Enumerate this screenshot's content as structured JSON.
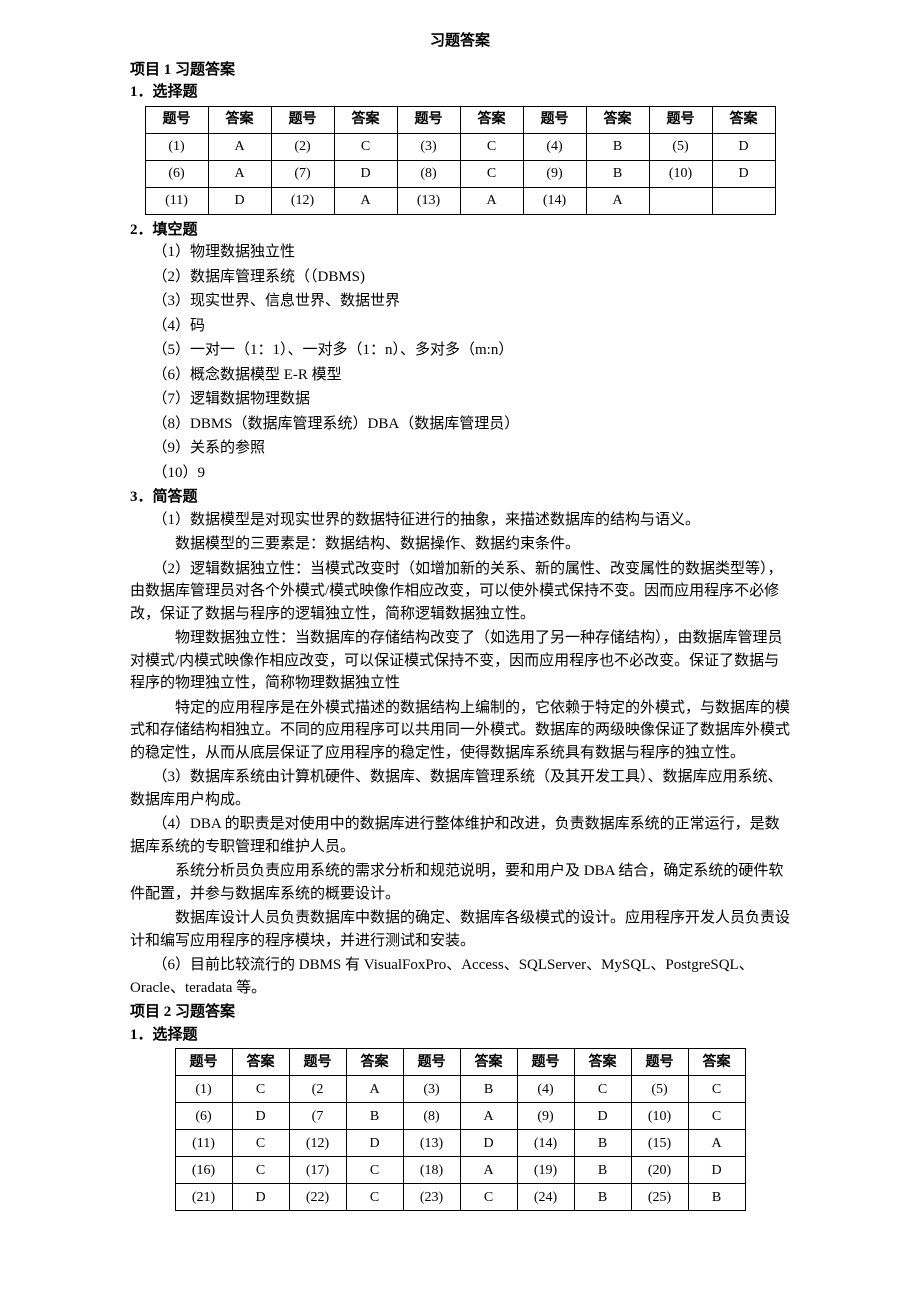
{
  "page_title": "习题答案",
  "project1": {
    "heading": "项目 1 习题答案",
    "section1": {
      "heading": "1．选择题",
      "headers": [
        "题号",
        "答案",
        "题号",
        "答案",
        "题号",
        "答案",
        "题号",
        "答案",
        "题号",
        "答案"
      ],
      "rows": [
        [
          "(1)",
          "A",
          "(2)",
          "C",
          "(3)",
          "C",
          "(4)",
          "B",
          "(5)",
          "D"
        ],
        [
          "(6)",
          "A",
          "(7)",
          "D",
          "(8)",
          "C",
          "(9)",
          "B",
          "(10)",
          "D"
        ],
        [
          "(11)",
          "D",
          "(12)",
          "A",
          "(13)",
          "A",
          "(14)",
          "A",
          "",
          ""
        ]
      ]
    },
    "section2": {
      "heading": "2．填空题",
      "items": [
        "（1）物理数据独立性",
        "（2）数据库管理系统（（DBMS)",
        "（3）现实世界、信息世界、数据世界",
        "（4）码",
        "（5）一对一（1：1）、一对多（1：n）、多对多（m:n）",
        "（6）概念数据模型 E-R 模型",
        "（7）逻辑数据物理数据",
        "（8）DBMS（数据库管理系统）DBA（数据库管理员）",
        "（9）关系的参照",
        "（10）9"
      ]
    },
    "section3": {
      "heading": "3．简答题",
      "paras": [
        {
          "cls": "indent",
          "text": "（1）数据模型是对现实世界的数据特征进行的抽象，来描述数据库的结构与语义。"
        },
        {
          "cls": "indent2",
          "text": "数据模型的三要素是：数据结构、数据操作、数据约束条件。"
        },
        {
          "cls": "indent",
          "text": "（2）逻辑数据独立性：当模式改变时（如增加新的关系、新的属性、改变属性的数据类型等），由数据库管理员对各个外模式/模式映像作相应改变，可以使外模式保持不变。因而应用程序不必修改，保证了数据与程序的逻辑独立性，简称逻辑数据独立性。"
        },
        {
          "cls": "indent2",
          "text": "物理数据独立性：当数据库的存储结构改变了（如选用了另一种存储结构），由数据库管理员对模式/内模式映像作相应改变，可以保证模式保持不变，因而应用程序也不必改变。保证了数据与程序的物理独立性，简称物理数据独立性"
        },
        {
          "cls": "indent2",
          "text": "特定的应用程序是在外模式描述的数据结构上编制的，它依赖于特定的外模式，与数据库的模式和存储结构相独立。不同的应用程序可以共用同一外模式。数据库的两级映像保证了数据库外模式的稳定性，从而从底层保证了应用程序的稳定性，使得数据库系统具有数据与程序的独立性。"
        },
        {
          "cls": "indent",
          "text": "（3）数据库系统由计算机硬件、数据库、数据库管理系统（及其开发工具）、数据库应用系统、数据库用户构成。"
        },
        {
          "cls": "indent",
          "text": "（4）DBA 的职责是对使用中的数据库进行整体维护和改进，负责数据库系统的正常运行，是数据库系统的专职管理和维护人员。"
        },
        {
          "cls": "indent2",
          "text": "系统分析员负责应用系统的需求分析和规范说明，要和用户及 DBA 结合，确定系统的硬件软件配置，并参与数据库系统的概要设计。"
        },
        {
          "cls": "indent2",
          "text": "数据库设计人员负责数据库中数据的确定、数据库各级模式的设计。应用程序开发人员负责设计和编写应用程序的程序模块，并进行测试和安装。"
        },
        {
          "cls": "indent",
          "text": "（6）目前比较流行的 DBMS 有 VisualFoxPro、Access、SQLServer、MySQL、PostgreSQL、Oracle、teradata 等。"
        }
      ]
    }
  },
  "project2": {
    "heading": "项目 2 习题答案",
    "section1": {
      "heading": "1．选择题",
      "headers": [
        "题号",
        "答案",
        "题号",
        "答案",
        "题号",
        "答案",
        "题号",
        "答案",
        "题号",
        "答案"
      ],
      "rows": [
        [
          "(1)",
          "C",
          "(2",
          "A",
          "(3)",
          "B",
          "(4)",
          "C",
          "(5)",
          "C"
        ],
        [
          "(6)",
          "D",
          "(7",
          "B",
          "(8)",
          "A",
          "(9)",
          "D",
          "(10)",
          "C"
        ],
        [
          "(11)",
          "C",
          "(12)",
          "D",
          "(13)",
          "D",
          "(14)",
          "B",
          "(15)",
          "A"
        ],
        [
          "(16)",
          "C",
          "(17)",
          "C",
          "(18)",
          "A",
          "(19)",
          "B",
          "(20)",
          "D"
        ],
        [
          "(21)",
          "D",
          "(22)",
          "C",
          "(23)",
          "C",
          "(24)",
          "B",
          "(25)",
          "B"
        ]
      ]
    }
  },
  "chart_data": [
    {
      "type": "table",
      "title": "项目1 选择题答案",
      "columns": [
        "题号",
        "答案"
      ],
      "rows": [
        [
          "(1)",
          "A"
        ],
        [
          "(2)",
          "C"
        ],
        [
          "(3)",
          "C"
        ],
        [
          "(4)",
          "B"
        ],
        [
          "(5)",
          "D"
        ],
        [
          "(6)",
          "A"
        ],
        [
          "(7)",
          "D"
        ],
        [
          "(8)",
          "C"
        ],
        [
          "(9)",
          "B"
        ],
        [
          "(10)",
          "D"
        ],
        [
          "(11)",
          "D"
        ],
        [
          "(12)",
          "A"
        ],
        [
          "(13)",
          "A"
        ],
        [
          "(14)",
          "A"
        ]
      ]
    },
    {
      "type": "table",
      "title": "项目2 选择题答案",
      "columns": [
        "题号",
        "答案"
      ],
      "rows": [
        [
          "(1)",
          "C"
        ],
        [
          "(2)",
          "A"
        ],
        [
          "(3)",
          "B"
        ],
        [
          "(4)",
          "C"
        ],
        [
          "(5)",
          "C"
        ],
        [
          "(6)",
          "D"
        ],
        [
          "(7)",
          "B"
        ],
        [
          "(8)",
          "A"
        ],
        [
          "(9)",
          "D"
        ],
        [
          "(10)",
          "C"
        ],
        [
          "(11)",
          "C"
        ],
        [
          "(12)",
          "D"
        ],
        [
          "(13)",
          "D"
        ],
        [
          "(14)",
          "B"
        ],
        [
          "(15)",
          "A"
        ],
        [
          "(16)",
          "C"
        ],
        [
          "(17)",
          "C"
        ],
        [
          "(18)",
          "A"
        ],
        [
          "(19)",
          "B"
        ],
        [
          "(20)",
          "D"
        ],
        [
          "(21)",
          "D"
        ],
        [
          "(22)",
          "C"
        ],
        [
          "(23)",
          "C"
        ],
        [
          "(24)",
          "B"
        ],
        [
          "(25)",
          "B"
        ]
      ]
    }
  ]
}
